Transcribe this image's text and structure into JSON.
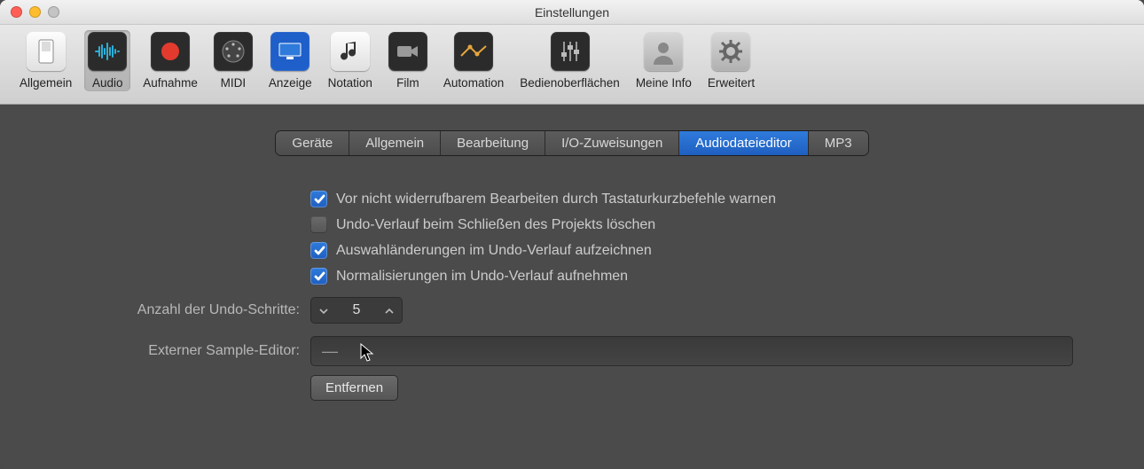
{
  "window": {
    "title": "Einstellungen"
  },
  "toolbar": {
    "items": [
      {
        "label": "Allgemein"
      },
      {
        "label": "Audio"
      },
      {
        "label": "Aufnahme"
      },
      {
        "label": "MIDI"
      },
      {
        "label": "Anzeige"
      },
      {
        "label": "Notation"
      },
      {
        "label": "Film"
      },
      {
        "label": "Automation"
      },
      {
        "label": "Bedienoberflächen"
      },
      {
        "label": "Meine Info"
      },
      {
        "label": "Erweitert"
      }
    ],
    "active_index": 1
  },
  "tabs": {
    "items": [
      {
        "label": "Geräte"
      },
      {
        "label": "Allgemein"
      },
      {
        "label": "Bearbeitung"
      },
      {
        "label": "I/O-Zuweisungen"
      },
      {
        "label": "Audiodateieditor"
      },
      {
        "label": "MP3"
      }
    ],
    "active_index": 4
  },
  "checkboxes": {
    "c0": {
      "checked": true,
      "label": "Vor nicht widerrufbarem Bearbeiten durch Tastaturkurzbefehle warnen"
    },
    "c1": {
      "checked": false,
      "label": "Undo-Verlauf beim Schließen des Projekts löschen"
    },
    "c2": {
      "checked": true,
      "label": "Auswahländerungen im Undo-Verlauf aufzeichnen"
    },
    "c3": {
      "checked": true,
      "label": "Normalisierungen im Undo-Verlauf aufnehmen"
    }
  },
  "undo_steps": {
    "label": "Anzahl der Undo-Schritte:",
    "value": "5"
  },
  "external_editor": {
    "label": "Externer Sample-Editor:",
    "value": "—"
  },
  "remove_button": {
    "label": "Entfernen"
  }
}
